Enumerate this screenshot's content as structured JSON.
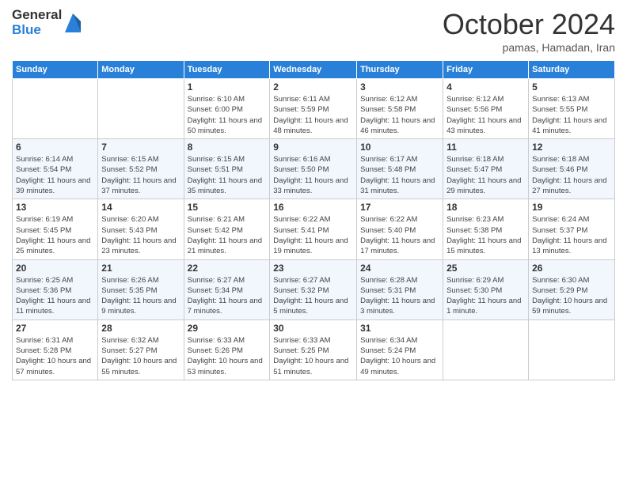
{
  "logo": {
    "general": "General",
    "blue": "Blue"
  },
  "header": {
    "month": "October 2024",
    "location": "pamas, Hamadan, Iran"
  },
  "days_of_week": [
    "Sunday",
    "Monday",
    "Tuesday",
    "Wednesday",
    "Thursday",
    "Friday",
    "Saturday"
  ],
  "weeks": [
    [
      {
        "day": "",
        "detail": ""
      },
      {
        "day": "",
        "detail": ""
      },
      {
        "day": "1",
        "detail": "Sunrise: 6:10 AM\nSunset: 6:00 PM\nDaylight: 11 hours and 50 minutes."
      },
      {
        "day": "2",
        "detail": "Sunrise: 6:11 AM\nSunset: 5:59 PM\nDaylight: 11 hours and 48 minutes."
      },
      {
        "day": "3",
        "detail": "Sunrise: 6:12 AM\nSunset: 5:58 PM\nDaylight: 11 hours and 46 minutes."
      },
      {
        "day": "4",
        "detail": "Sunrise: 6:12 AM\nSunset: 5:56 PM\nDaylight: 11 hours and 43 minutes."
      },
      {
        "day": "5",
        "detail": "Sunrise: 6:13 AM\nSunset: 5:55 PM\nDaylight: 11 hours and 41 minutes."
      }
    ],
    [
      {
        "day": "6",
        "detail": "Sunrise: 6:14 AM\nSunset: 5:54 PM\nDaylight: 11 hours and 39 minutes."
      },
      {
        "day": "7",
        "detail": "Sunrise: 6:15 AM\nSunset: 5:52 PM\nDaylight: 11 hours and 37 minutes."
      },
      {
        "day": "8",
        "detail": "Sunrise: 6:15 AM\nSunset: 5:51 PM\nDaylight: 11 hours and 35 minutes."
      },
      {
        "day": "9",
        "detail": "Sunrise: 6:16 AM\nSunset: 5:50 PM\nDaylight: 11 hours and 33 minutes."
      },
      {
        "day": "10",
        "detail": "Sunrise: 6:17 AM\nSunset: 5:48 PM\nDaylight: 11 hours and 31 minutes."
      },
      {
        "day": "11",
        "detail": "Sunrise: 6:18 AM\nSunset: 5:47 PM\nDaylight: 11 hours and 29 minutes."
      },
      {
        "day": "12",
        "detail": "Sunrise: 6:18 AM\nSunset: 5:46 PM\nDaylight: 11 hours and 27 minutes."
      }
    ],
    [
      {
        "day": "13",
        "detail": "Sunrise: 6:19 AM\nSunset: 5:45 PM\nDaylight: 11 hours and 25 minutes."
      },
      {
        "day": "14",
        "detail": "Sunrise: 6:20 AM\nSunset: 5:43 PM\nDaylight: 11 hours and 23 minutes."
      },
      {
        "day": "15",
        "detail": "Sunrise: 6:21 AM\nSunset: 5:42 PM\nDaylight: 11 hours and 21 minutes."
      },
      {
        "day": "16",
        "detail": "Sunrise: 6:22 AM\nSunset: 5:41 PM\nDaylight: 11 hours and 19 minutes."
      },
      {
        "day": "17",
        "detail": "Sunrise: 6:22 AM\nSunset: 5:40 PM\nDaylight: 11 hours and 17 minutes."
      },
      {
        "day": "18",
        "detail": "Sunrise: 6:23 AM\nSunset: 5:38 PM\nDaylight: 11 hours and 15 minutes."
      },
      {
        "day": "19",
        "detail": "Sunrise: 6:24 AM\nSunset: 5:37 PM\nDaylight: 11 hours and 13 minutes."
      }
    ],
    [
      {
        "day": "20",
        "detail": "Sunrise: 6:25 AM\nSunset: 5:36 PM\nDaylight: 11 hours and 11 minutes."
      },
      {
        "day": "21",
        "detail": "Sunrise: 6:26 AM\nSunset: 5:35 PM\nDaylight: 11 hours and 9 minutes."
      },
      {
        "day": "22",
        "detail": "Sunrise: 6:27 AM\nSunset: 5:34 PM\nDaylight: 11 hours and 7 minutes."
      },
      {
        "day": "23",
        "detail": "Sunrise: 6:27 AM\nSunset: 5:32 PM\nDaylight: 11 hours and 5 minutes."
      },
      {
        "day": "24",
        "detail": "Sunrise: 6:28 AM\nSunset: 5:31 PM\nDaylight: 11 hours and 3 minutes."
      },
      {
        "day": "25",
        "detail": "Sunrise: 6:29 AM\nSunset: 5:30 PM\nDaylight: 11 hours and 1 minute."
      },
      {
        "day": "26",
        "detail": "Sunrise: 6:30 AM\nSunset: 5:29 PM\nDaylight: 10 hours and 59 minutes."
      }
    ],
    [
      {
        "day": "27",
        "detail": "Sunrise: 6:31 AM\nSunset: 5:28 PM\nDaylight: 10 hours and 57 minutes."
      },
      {
        "day": "28",
        "detail": "Sunrise: 6:32 AM\nSunset: 5:27 PM\nDaylight: 10 hours and 55 minutes."
      },
      {
        "day": "29",
        "detail": "Sunrise: 6:33 AM\nSunset: 5:26 PM\nDaylight: 10 hours and 53 minutes."
      },
      {
        "day": "30",
        "detail": "Sunrise: 6:33 AM\nSunset: 5:25 PM\nDaylight: 10 hours and 51 minutes."
      },
      {
        "day": "31",
        "detail": "Sunrise: 6:34 AM\nSunset: 5:24 PM\nDaylight: 10 hours and 49 minutes."
      },
      {
        "day": "",
        "detail": ""
      },
      {
        "day": "",
        "detail": ""
      }
    ]
  ]
}
